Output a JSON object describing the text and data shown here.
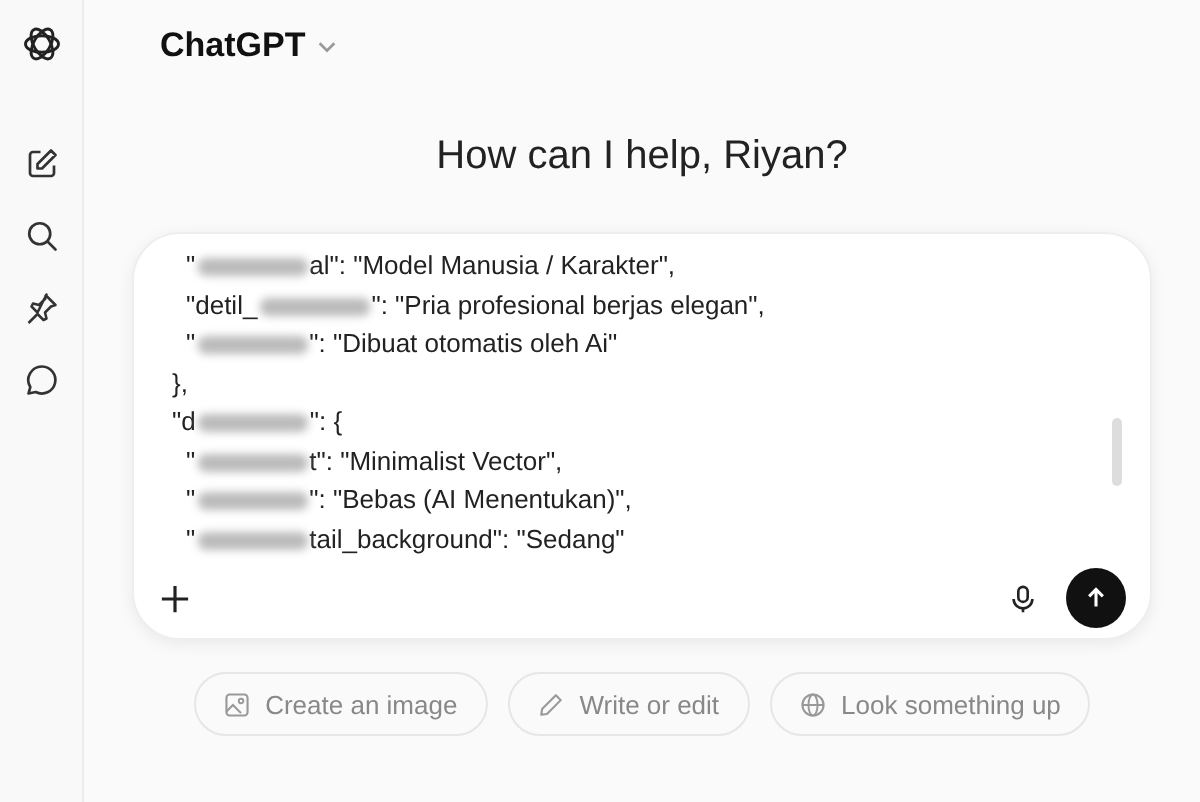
{
  "header": {
    "title": "ChatGPT"
  },
  "greeting": "How can I help, Riyan?",
  "composer": {
    "lines": [
      {
        "indent": true,
        "before": "\"",
        "redacted": true,
        "after": "al\": \"Model Manusia / Karakter\","
      },
      {
        "indent": true,
        "before": "\"detil_",
        "redacted": true,
        "after": "\": \"Pria profesional berjas elegan\","
      },
      {
        "indent": true,
        "before": "\"",
        "redacted": true,
        "after": "\": \"Dibuat otomatis oleh Ai\""
      },
      {
        "indent": false,
        "before": "},",
        "redacted": false
      },
      {
        "indent": false,
        "before": "\"d",
        "redacted": true,
        "after": "\": {"
      },
      {
        "indent": true,
        "before": "\"",
        "redacted": true,
        "after": "t\": \"Minimalist Vector\","
      },
      {
        "indent": true,
        "before": "\"",
        "redacted": true,
        "after": "\": \"Bebas (AI Menentukan)\","
      },
      {
        "indent": true,
        "before": "\"",
        "redacted": true,
        "after": "tail_background\": \"Sedang\""
      }
    ]
  },
  "suggestions": [
    {
      "kind": "image",
      "label": "Create an image"
    },
    {
      "kind": "write",
      "label": "Write or edit"
    },
    {
      "kind": "search",
      "label": "Look something up"
    }
  ]
}
